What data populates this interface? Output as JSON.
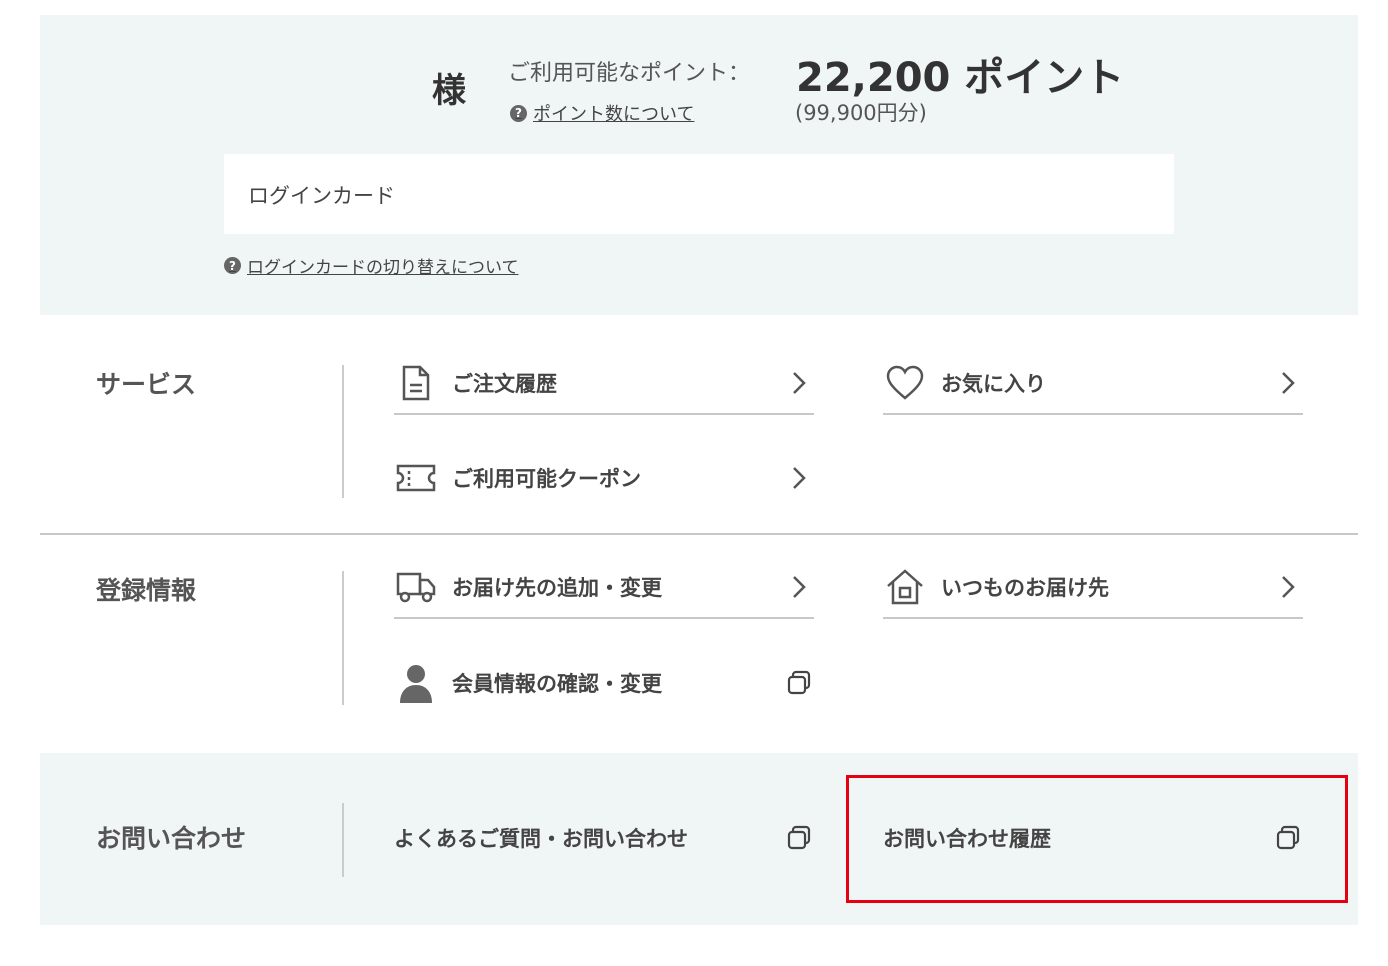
{
  "header": {
    "honorific": "様",
    "points_label": "ご利用可能なポイント：",
    "points_value": "22,200 ポイント",
    "points_yen": "(99,900円分)",
    "points_help": "ポイント数について",
    "login_card_label": "ログインカード",
    "login_card_help": "ログインカードの切り替えについて"
  },
  "services": {
    "title": "サービス",
    "items": [
      {
        "label": "ご注文履歴",
        "icon": "document-icon"
      },
      {
        "label": "お気に入り",
        "icon": "heart-icon"
      },
      {
        "label": "ご利用可能クーポン",
        "icon": "coupon-icon"
      }
    ]
  },
  "registration": {
    "title": "登録情報",
    "items": [
      {
        "label": "お届け先の追加・変更",
        "icon": "truck-icon"
      },
      {
        "label": "いつものお届け先",
        "icon": "house-icon"
      },
      {
        "label": "会員情報の確認・変更",
        "icon": "person-icon"
      }
    ]
  },
  "contact": {
    "title": "お問い合わせ",
    "items": [
      {
        "label": "よくあるご質問・お問い合わせ",
        "icon": "external-window-icon"
      },
      {
        "label": "お問い合わせ履歴",
        "icon": "external-window-icon"
      }
    ]
  },
  "colors": {
    "panel_bg": "#f0f5f5",
    "highlight": "#e60012",
    "divider": "#c8c8c8"
  }
}
